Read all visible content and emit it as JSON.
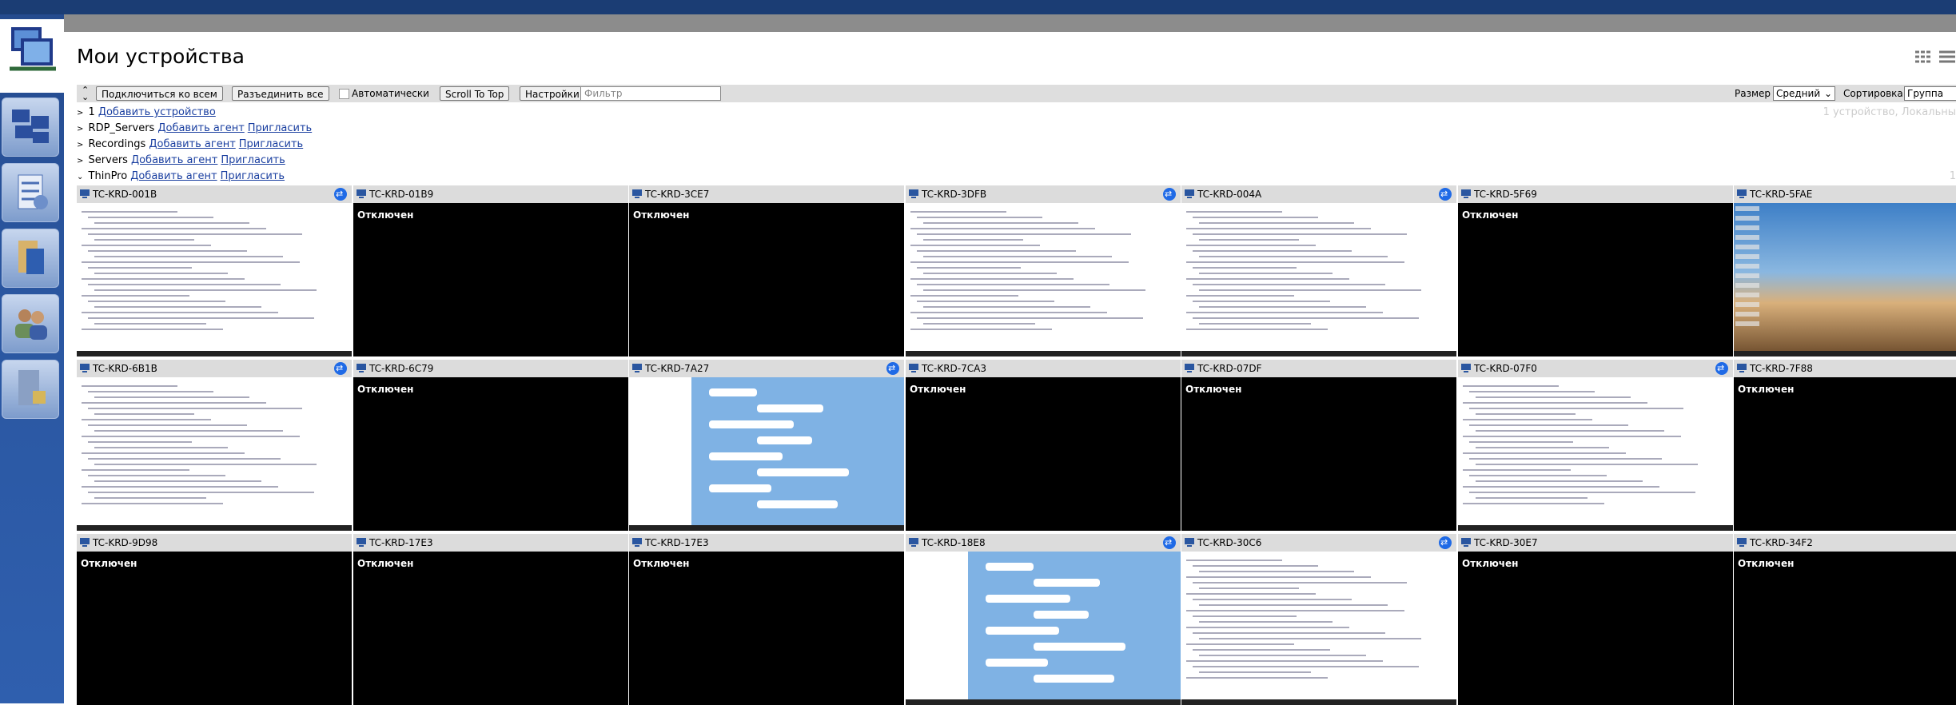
{
  "page": {
    "title": "Мои устройства"
  },
  "toolbar": {
    "connect_all": "Подключиться ко всем",
    "disconnect_all": "Разъединить все",
    "auto_label": "Автоматически",
    "scroll_top": "Scroll To Top",
    "settings": "Настройки",
    "filter_placeholder": "Фильтр",
    "size_label": "Размер",
    "size_value": "Средний",
    "sort_label": "Сортировка",
    "sort_value": "Группа"
  },
  "groups": [
    {
      "name": "1",
      "links": [
        "Добавить устройство"
      ],
      "note": "1 устройство, Локальны"
    },
    {
      "name": "RDP_Servers",
      "links": [
        "Добавить агент",
        "Пригласить"
      ]
    },
    {
      "name": "Recordings",
      "links": [
        "Добавить агент",
        "Пригласить"
      ]
    },
    {
      "name": "Servers",
      "links": [
        "Добавить агент",
        "Пригласить"
      ]
    },
    {
      "name": "ThinPro",
      "links": [
        "Добавить агент",
        "Пригласить"
      ],
      "note": "1"
    }
  ],
  "offline_label": "Отключен",
  "devices": [
    {
      "name": "TC-KRD-001B",
      "status": "online",
      "screen": "doc"
    },
    {
      "name": "TC-KRD-01B9",
      "status": "offline"
    },
    {
      "name": "TC-KRD-3CE7",
      "status": "offline"
    },
    {
      "name": "TC-KRD-3DFB",
      "status": "online",
      "screen": "doc"
    },
    {
      "name": "TC-KRD-004A",
      "status": "online",
      "screen": "doc"
    },
    {
      "name": "TC-KRD-5F69",
      "status": "offline"
    },
    {
      "name": "TC-KRD-5FAE",
      "status": "online-nosync",
      "screen": "desk"
    },
    {
      "name": "TC-KRD-6B1B",
      "status": "online",
      "screen": "doc"
    },
    {
      "name": "TC-KRD-6C79",
      "status": "offline"
    },
    {
      "name": "TC-KRD-7A27",
      "status": "online",
      "screen": "telegram"
    },
    {
      "name": "TC-KRD-7CA3",
      "status": "offline"
    },
    {
      "name": "TC-KRD-07DF",
      "status": "offline"
    },
    {
      "name": "TC-KRD-07F0",
      "status": "online",
      "screen": "doc"
    },
    {
      "name": "TC-KRD-7F88",
      "status": "offline"
    },
    {
      "name": "TC-KRD-9D98",
      "status": "offline"
    },
    {
      "name": "TC-KRD-17E3",
      "status": "offline"
    },
    {
      "name": "TC-KRD-17E3",
      "status": "offline"
    },
    {
      "name": "TC-KRD-18E8",
      "status": "online",
      "screen": "telegram"
    },
    {
      "name": "TC-KRD-30C6",
      "status": "online",
      "screen": "doc"
    },
    {
      "name": "TC-KRD-30E7",
      "status": "offline"
    },
    {
      "name": "TC-KRD-34F2",
      "status": "offline"
    }
  ],
  "colors": {
    "sidebar": "#2a56a0",
    "topband": "#1b3d74",
    "sync": "#1f6ae6",
    "link": "#1a3fa0"
  }
}
